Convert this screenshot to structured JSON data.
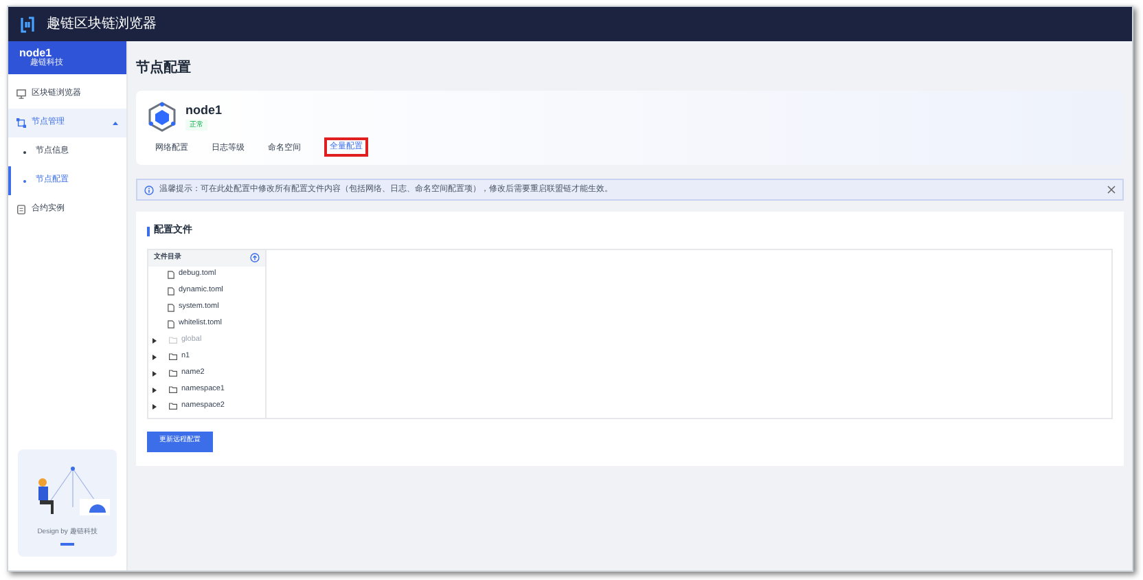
{
  "header": {
    "title": "趣链区块链浏览器"
  },
  "sidebar": {
    "node": {
      "name": "node1",
      "subtitle": "趣链科技"
    },
    "items": [
      {
        "label": "区块链浏览器",
        "kind": "monitor",
        "selected": false
      },
      {
        "label": "节点管理",
        "kind": "nodes",
        "selected": true,
        "expanded": true,
        "children": [
          {
            "label": "节点信息",
            "selected": false
          },
          {
            "label": "节点配置",
            "selected": true
          }
        ]
      },
      {
        "label": "合约实例",
        "kind": "contract",
        "selected": false
      }
    ],
    "footer": {
      "text": "Design by 趣链科技"
    }
  },
  "page_title": "节点配置",
  "node_card": {
    "name": "node1",
    "status": "正常",
    "tabs": [
      {
        "label": "网络配置",
        "selected": false
      },
      {
        "label": "日志等级",
        "selected": false
      },
      {
        "label": "命名空间",
        "selected": false
      },
      {
        "label": "全量配置",
        "selected": true
      }
    ]
  },
  "alert": {
    "text": "温馨提示：可在此处配置中修改所有配置文件内容（包括网络、日志、命名空间配置项），修改后需要重启联盟链才能生效。"
  },
  "config": {
    "title": "配置文件",
    "tree_header": "文件目录",
    "tree": [
      {
        "kind": "file",
        "label": "debug.toml",
        "disabled": false
      },
      {
        "kind": "file",
        "label": "dynamic.toml",
        "disabled": false
      },
      {
        "kind": "file",
        "label": "system.toml",
        "disabled": false
      },
      {
        "kind": "file",
        "label": "whitelist.toml",
        "disabled": false
      },
      {
        "kind": "folder",
        "label": "global",
        "disabled": true,
        "expanded": false
      },
      {
        "kind": "folder",
        "label": "n1",
        "disabled": false,
        "expanded": false
      },
      {
        "kind": "folder",
        "label": "name2",
        "disabled": false,
        "expanded": false
      },
      {
        "kind": "folder",
        "label": "namespace1",
        "disabled": false,
        "expanded": false
      },
      {
        "kind": "folder",
        "label": "namespace2",
        "disabled": false,
        "expanded": false
      }
    ],
    "button": "更新远程配置"
  }
}
